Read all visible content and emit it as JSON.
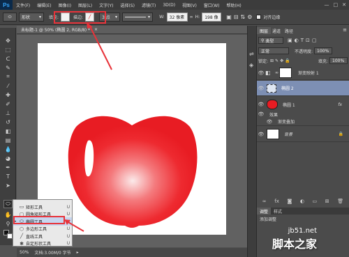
{
  "app": {
    "logo": "Ps"
  },
  "menubar": {
    "items": [
      "文件(F)",
      "编辑(E)",
      "图像(I)",
      "图层(L)",
      "文字(Y)",
      "选择(S)",
      "滤镜(T)",
      "3D(D)",
      "视图(V)",
      "窗口(W)",
      "帮助(H)"
    ],
    "window_controls": [
      "—",
      "□",
      "✕"
    ]
  },
  "options": {
    "mode_value": "形状",
    "fill_label": "填充:",
    "stroke_label": "描边:",
    "stroke_width": "3 点",
    "w_label": "W:",
    "w_value": "32 像素",
    "h_label": "H:",
    "h_value": "198 像",
    "align_edges_label": "对齐边缘",
    "fill_color": "#ffffff"
  },
  "document": {
    "tab_title": "未标题-1 @ 50% (椭圆 2, RGB/8) *",
    "zoom": "50%",
    "doc_info": "文档:3.00M/0 字节"
  },
  "flyout": {
    "items": [
      {
        "label": "矩形工具",
        "key": "U",
        "icon": "rectangle-icon",
        "glyph": "▭",
        "selected": false,
        "bullet": ""
      },
      {
        "label": "圆角矩形工具",
        "key": "U",
        "icon": "rounded-rectangle-icon",
        "glyph": "▢",
        "selected": false,
        "bullet": ""
      },
      {
        "label": "椭圆工具",
        "key": "U",
        "icon": "ellipse-icon",
        "glyph": "⬭",
        "selected": true,
        "bullet": "•"
      },
      {
        "label": "多边形工具",
        "key": "U",
        "icon": "polygon-icon",
        "glyph": "⬡",
        "selected": false,
        "bullet": ""
      },
      {
        "label": "直线工具",
        "key": "U",
        "icon": "line-icon",
        "glyph": "╱",
        "selected": false,
        "bullet": ""
      },
      {
        "label": "自定形状工具",
        "key": "U",
        "icon": "custom-shape-icon",
        "glyph": "✱",
        "selected": false,
        "bullet": ""
      }
    ]
  },
  "layers_panel": {
    "tabs": [
      "图层",
      "通道",
      "路径"
    ],
    "filter_value": "类型",
    "blend_mode": "正常",
    "opacity_label": "不透明度:",
    "opacity_value": "100%",
    "lock_label": "锁定:",
    "fill_label": "填充:",
    "fill_value": "100%",
    "layers": [
      {
        "name": "渐变映射 1",
        "selected": false
      },
      {
        "name": "椭圆 2",
        "selected": true
      },
      {
        "name": "椭圆 1",
        "selected": false,
        "fx": "fx"
      },
      {
        "name": "效果",
        "sub": true
      },
      {
        "name": "渐变叠加",
        "sub": true
      },
      {
        "name": "背景",
        "selected": false,
        "italic": true
      }
    ]
  },
  "adjust_panel": {
    "tabs": [
      "调整",
      "样式"
    ],
    "title": "添加调整"
  },
  "watermark": {
    "site": "jb51.net",
    "brand": "脚本之家"
  },
  "colors": {
    "accent_red": "#e8333a",
    "apple_red": "#ee1c24",
    "selected_layer": "#7d8fb4"
  }
}
